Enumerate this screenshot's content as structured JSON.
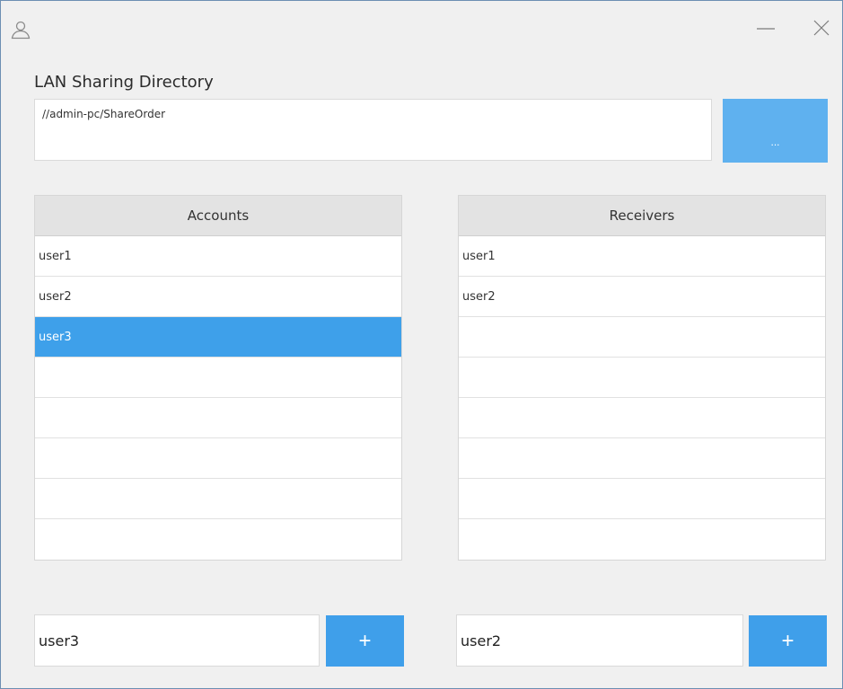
{
  "window": {
    "icons": {
      "app": "user-icon",
      "minimize": "minimize-icon",
      "close": "close-icon"
    }
  },
  "directory": {
    "label": "LAN Sharing Directory",
    "value": "//admin-pc/ShareOrder",
    "browse_label": "..."
  },
  "accounts": {
    "header": "Accounts",
    "rows": [
      "user1",
      "user2",
      "user3",
      "",
      "",
      "",
      "",
      ""
    ],
    "selected": "user3",
    "input_value": "user3",
    "add_label": "+"
  },
  "receivers": {
    "header": "Receivers",
    "rows": [
      "user1",
      "user2",
      "",
      "",
      "",
      "",
      "",
      ""
    ],
    "input_value": "user2",
    "add_label": "+"
  },
  "colors": {
    "accent": "#3f9fea",
    "accent_light": "#5fb1ef",
    "window_bg": "#f0f0f0",
    "header_bg": "#e3e3e3"
  }
}
